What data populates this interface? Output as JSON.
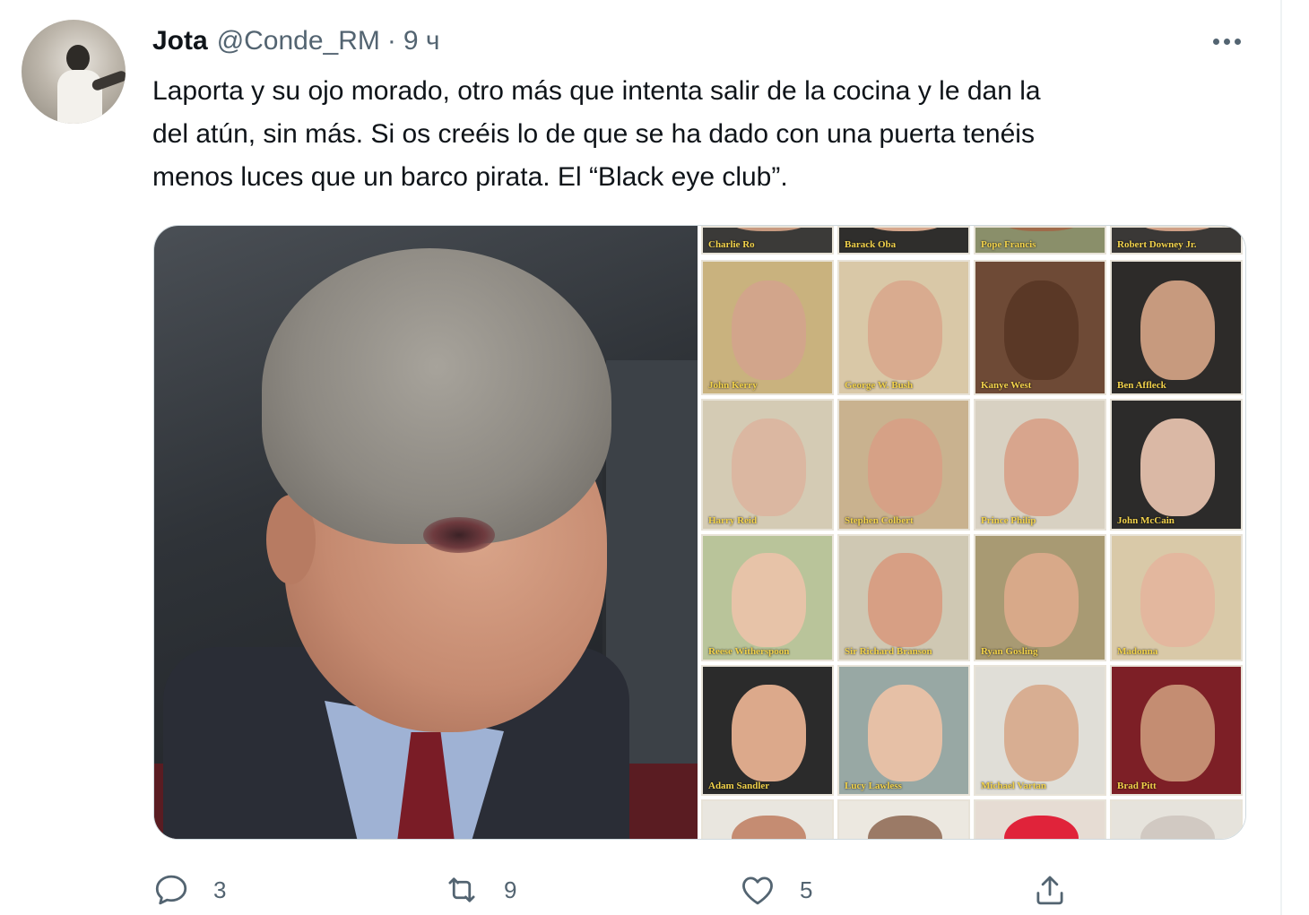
{
  "tweet": {
    "author_name": "Jota",
    "author_handle": "@Conde_RM",
    "separator": "·",
    "timestamp": "9 ч",
    "text_lines": [
      "Laporta y su ojo morado, otro más que intenta salir de la cocina y le dan la",
      "del atún, sin más. Si os creéis lo de que se ha dado con una puerta tenéis",
      "menos luces que un barco pirata. El “Black eye club”."
    ]
  },
  "media": {
    "collage_rows": [
      [
        "Charlie Ro",
        "Barack Oba",
        "Pope Francis",
        "Robert Downey Jr."
      ],
      [
        "John Kerry",
        "George W. Bush",
        "Kanye West",
        "Ben Affleck"
      ],
      [
        "Harry Reid",
        "Stephen Colbert",
        "Prince Philip",
        "John McCain"
      ],
      [
        "Reese Witherspoon",
        "Sir Richard Branson",
        "Ryan Gosling",
        "Madonna"
      ],
      [
        "Adam Sandler",
        "Lucy Lawless",
        "Michael Vartan",
        "Brad Pitt"
      ],
      [
        "",
        "",
        "",
        ""
      ]
    ],
    "cell_colors": [
      [
        "#3b3a38",
        "#2f2e2c",
        "#8a8f6a",
        "#3a3836"
      ],
      [
        "#c9b27e",
        "#d9c8a7",
        "#6e4a36",
        "#2d2b29"
      ],
      [
        "#d4cbb4",
        "#c9b28f",
        "#d8d1c2",
        "#2c2b2a"
      ],
      [
        "#b9c49a",
        "#cfc8b3",
        "#a89a73",
        "#d9c9a8"
      ],
      [
        "#2b2b2b",
        "#98a8a4",
        "#e0ded7",
        "#7d1f26"
      ],
      [
        "#e9e6df",
        "#ece8e0",
        "#e6dcd3",
        "#e6e3dc"
      ]
    ],
    "face_colors": [
      [
        "#c89a80",
        "#d7a88d",
        "#a06b4a",
        "#d0a086"
      ],
      [
        "#d2a58b",
        "#d9ab8f",
        "#5a3826",
        "#c79a7e"
      ],
      [
        "#dbb7a1",
        "#d6a186",
        "#d8a58d",
        "#dab8a5"
      ],
      [
        "#e7c3a8",
        "#d79f84",
        "#d8a989",
        "#e3b79e"
      ],
      [
        "#dca98b",
        "#e6c0a6",
        "#d8ae92",
        "#c48d72"
      ],
      [
        "#c58c72",
        "#9b7a66",
        "#e0233a",
        "#d1c9c2"
      ]
    ]
  },
  "actions": {
    "reply_count": "3",
    "retweet_count": "9",
    "like_count": "5"
  },
  "colors": {
    "text_primary": "#0f1419",
    "text_secondary": "#536471",
    "border": "#cfd9de"
  }
}
